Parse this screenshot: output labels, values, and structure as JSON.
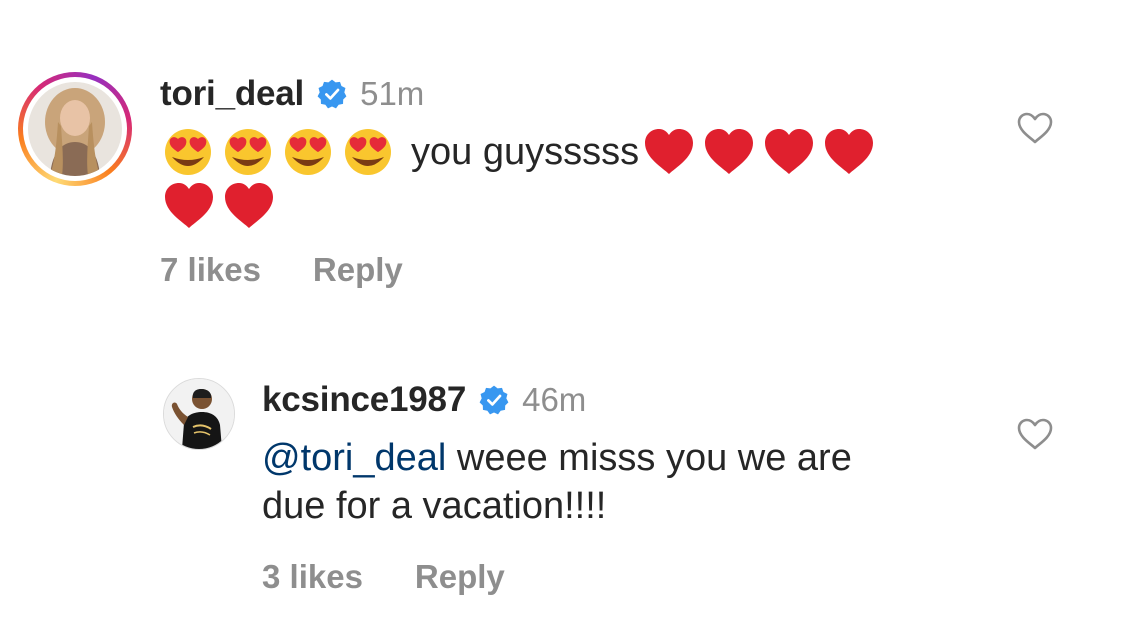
{
  "comments": [
    {
      "username": "tori_deal",
      "verified": true,
      "time": "51m",
      "text": "you guysssss",
      "likes": "7 likes",
      "reply_label": "Reply",
      "emoji_before": [
        "heart-eyes",
        "heart-eyes",
        "heart-eyes",
        "heart-eyes"
      ],
      "emoji_after_line1": [
        "red-heart",
        "red-heart",
        "red-heart",
        "red-heart"
      ],
      "emoji_line2": [
        "red-heart",
        "red-heart"
      ],
      "avatar_ring": "story-gradient"
    },
    {
      "username": "kcsince1987",
      "verified": true,
      "time": "46m",
      "mention": "@tori_deal",
      "text_line1": " weee misss you we are",
      "text_line2": "due for a vacation!!!!",
      "likes": "3 likes",
      "reply_label": "Reply"
    }
  ],
  "icons": {
    "verified": "verified-badge-icon",
    "like": "heart-outline-icon"
  },
  "colors": {
    "username": "#262626",
    "secondary": "#8e8e8e",
    "mention": "#00376b",
    "verified": "#3897f0",
    "heart_emoji": "#e0202e"
  }
}
